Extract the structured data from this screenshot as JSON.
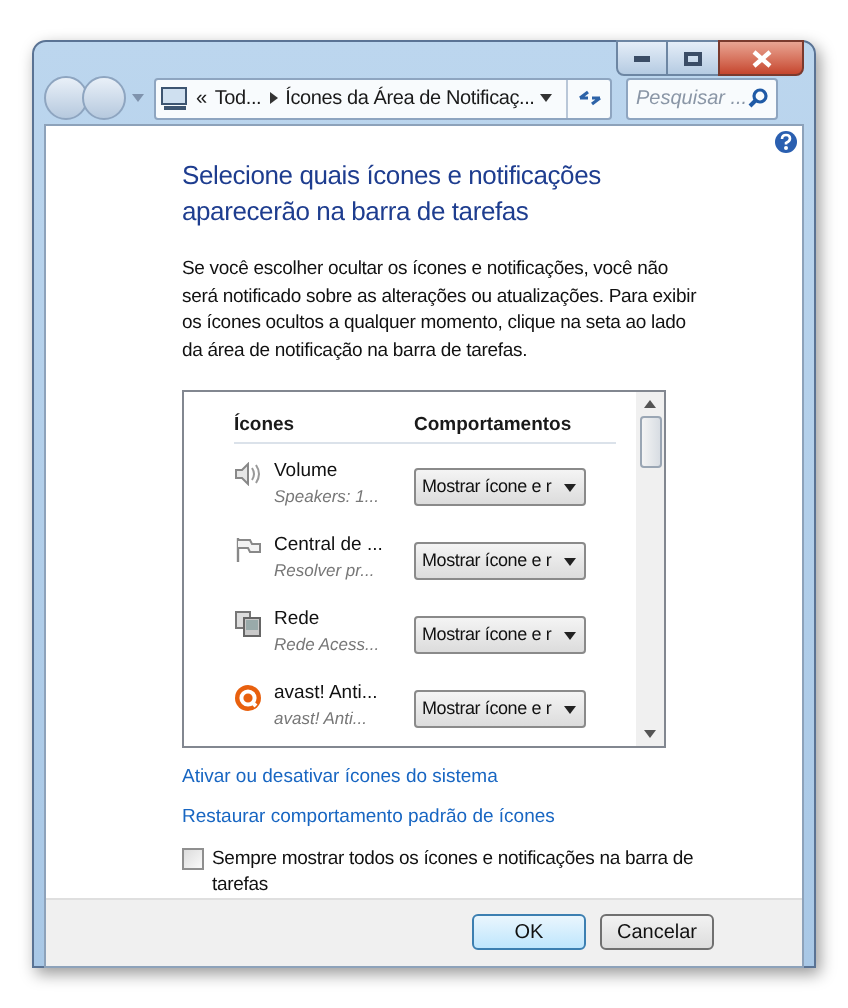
{
  "address_bar": {
    "overflow": "«",
    "crumbs": [
      "Tod...",
      "Ícones da Área de Notificaç..."
    ]
  },
  "search": {
    "placeholder": "Pesquisar ..."
  },
  "heading": "Selecione quais ícones e notificações aparecerão na barra de tarefas",
  "description": "Se você escolher ocultar os ícones e notificações, você não será notificado sobre as alterações ou atualizações. Para exibir os ícones ocultos a qualquer momento, clique na seta ao lado da área de notificação na barra de tarefas.",
  "table": {
    "columns": [
      "Ícones",
      "Comportamentos"
    ],
    "rows": [
      {
        "kind": "speaker",
        "name": "Volume",
        "detail": "Speakers: 1...",
        "behavior": "Mostrar ícone e r"
      },
      {
        "kind": "flag",
        "name": "Central de ...",
        "detail": "Resolver pr...",
        "behavior": "Mostrar ícone e r"
      },
      {
        "kind": "network",
        "name": "Rede",
        "detail": "Rede Acess...",
        "behavior": "Mostrar ícone e r"
      },
      {
        "kind": "antivirus",
        "name": "avast! Anti...",
        "detail": "avast! Anti...",
        "behavior": "Mostrar ícone e r"
      }
    ]
  },
  "links": [
    "Ativar ou desativar ícones do sistema",
    "Restaurar comportamento padrão de ícones"
  ],
  "always_show": {
    "label": "Sempre mostrar todos os ícones e notificações na barra de tarefas",
    "checked": false
  },
  "buttons": [
    "OK",
    "Cancelar"
  ]
}
